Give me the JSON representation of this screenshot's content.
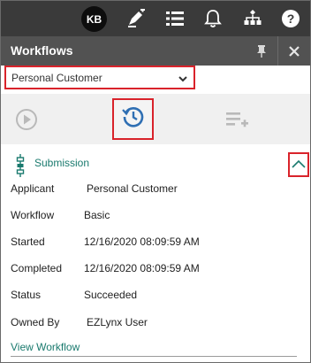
{
  "toolbar": {
    "avatar_initials": "KB",
    "icons": [
      "edit-note-icon",
      "list-icon",
      "bell-icon",
      "workflow-tree-icon",
      "help-icon"
    ]
  },
  "panel": {
    "title": "Workflows",
    "header_icons": [
      "pin-icon",
      "close-icon"
    ]
  },
  "selector": {
    "selected": "Personal Customer"
  },
  "actions": {
    "icons": [
      "play-icon",
      "history-icon",
      "add-list-icon"
    ]
  },
  "section": {
    "label": "Submission"
  },
  "details": [
    {
      "key": "Applicant",
      "value": "Personal Customer"
    },
    {
      "key": "Workflow",
      "value": "Basic"
    },
    {
      "key": "Started",
      "value": "12/16/2020 08:09:59 AM"
    },
    {
      "key": "Completed",
      "value": "12/16/2020 08:09:59 AM"
    },
    {
      "key": "Status",
      "value": "Succeeded"
    },
    {
      "key": "Owned By",
      "value": "EZLynx User"
    }
  ],
  "link": {
    "view_workflow": "View Workflow"
  },
  "colors": {
    "toolbar_bg": "#3a3a3a",
    "header_bg": "#525252",
    "accent_teal": "#1a7a6e",
    "accent_blue": "#2f6fb3",
    "highlight_red": "#d9232b"
  }
}
